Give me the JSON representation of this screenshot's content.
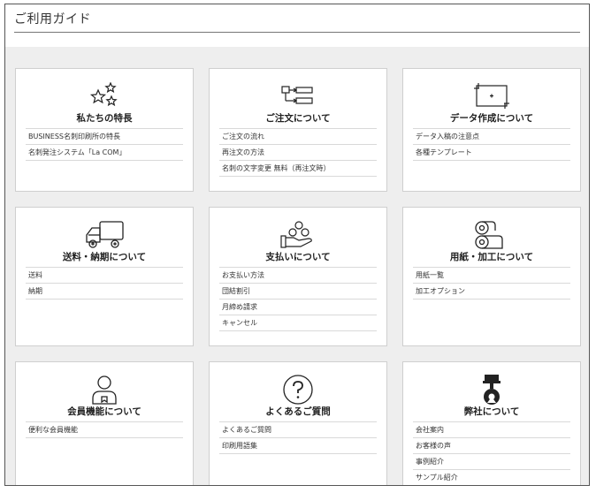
{
  "page": {
    "title": "ご利用ガイド"
  },
  "cards": [
    {
      "title": "私たちの特長",
      "icon": "stars-icon",
      "links": [
        "BUSINESS名刺印刷所の特長",
        "名刺発注システム「La COM」"
      ]
    },
    {
      "title": "ご注文について",
      "icon": "order-flow-icon",
      "links": [
        "ご注文の流れ",
        "再注文の方法",
        "名刺の文字変更 無料（再注文時）"
      ]
    },
    {
      "title": "データ作成について",
      "icon": "data-frame-icon",
      "links": [
        "データ入稿の注意点",
        "各種テンプレート"
      ]
    },
    {
      "title": "送料・納期について",
      "icon": "truck-icon",
      "links": [
        "送料",
        "納期"
      ]
    },
    {
      "title": "支払いについて",
      "icon": "payment-hand-icon",
      "links": [
        "お支払い方法",
        "団結割引",
        "月締め請求",
        "キャンセル"
      ]
    },
    {
      "title": "用紙・加工について",
      "icon": "paper-rolls-icon",
      "links": [
        "用紙一覧",
        "加工オプション"
      ]
    },
    {
      "title": "会員機能について",
      "icon": "member-icon",
      "links": [
        "便利な会員機能"
      ]
    },
    {
      "title": "よくあるご質問",
      "icon": "question-icon",
      "links": [
        "よくあるご質問",
        "印刷用語集"
      ]
    },
    {
      "title": "弊社について",
      "icon": "company-icon",
      "links": [
        "会社案内",
        "お客様の声",
        "事例紹介",
        "サンプル紹介"
      ]
    }
  ]
}
